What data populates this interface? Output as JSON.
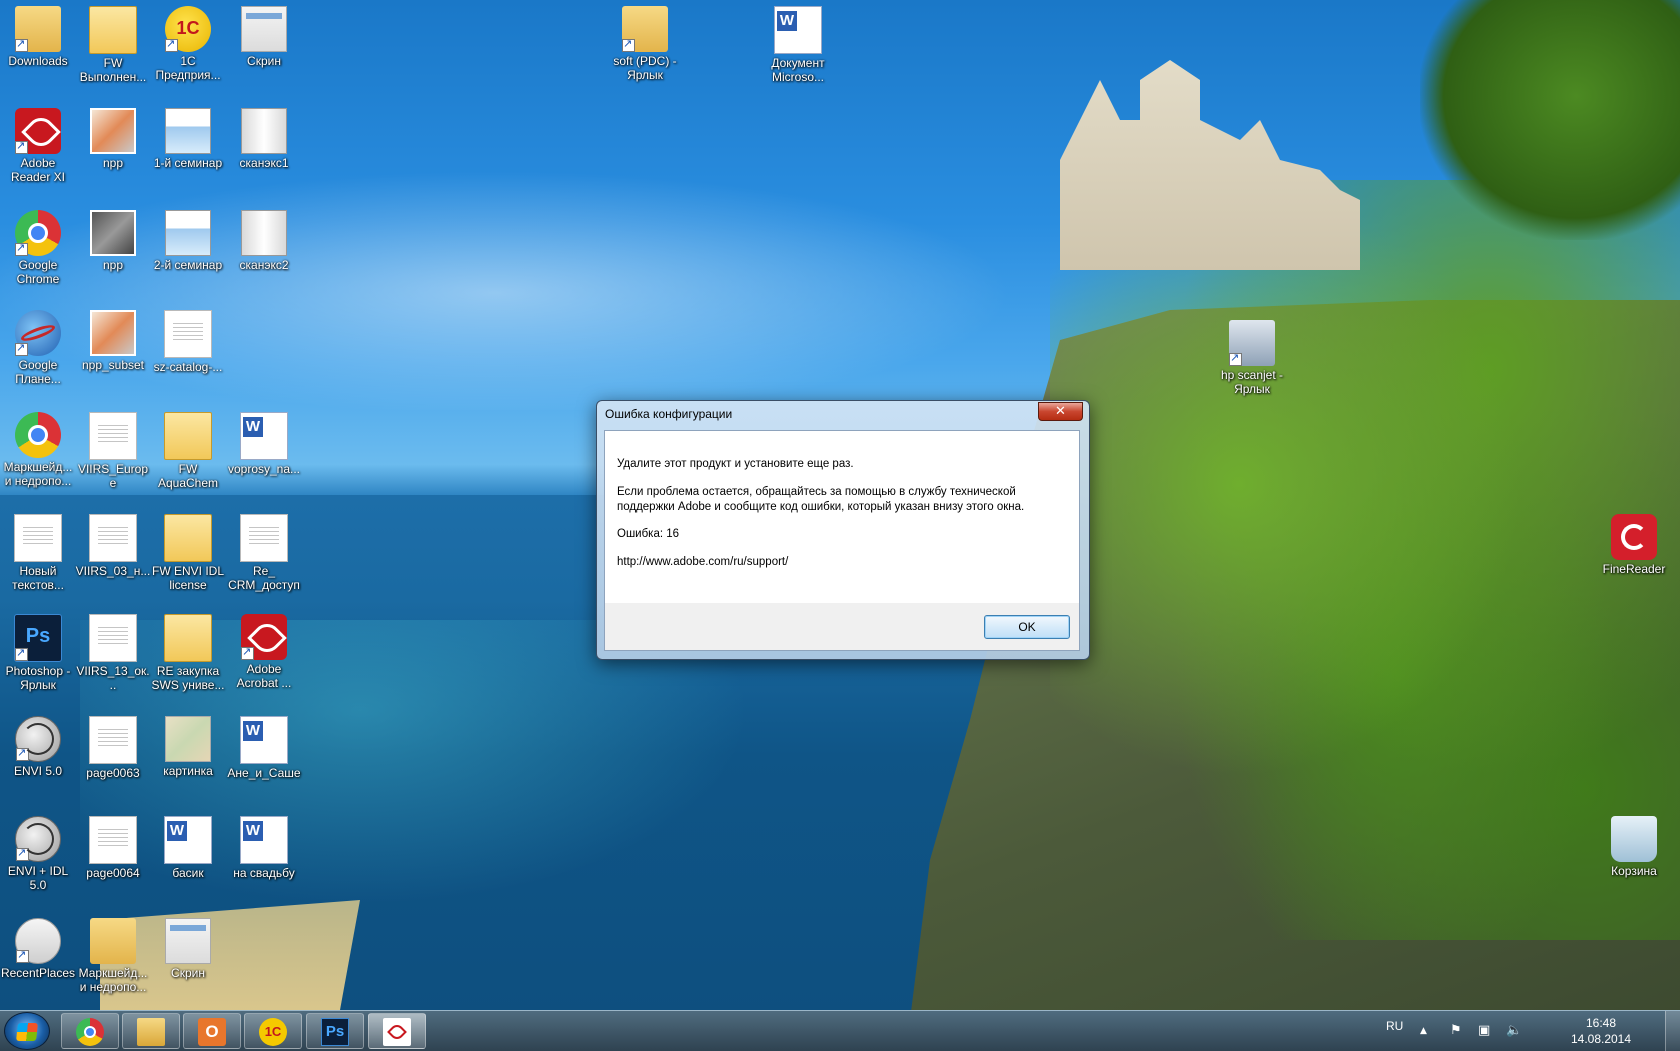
{
  "desktop_icons": [
    {
      "label": "Downloads",
      "icon": "folder-icon"
    },
    {
      "label": "FW Выполнен...",
      "icon": "mail-icon"
    },
    {
      "label": "1C Предприя...",
      "icon": "1c-icon"
    },
    {
      "label": "Скрин",
      "icon": "screenshot-icon"
    },
    {
      "label": "Adobe Reader XI",
      "icon": "pdf-icon"
    },
    {
      "label": "npp",
      "icon": "image-icon"
    },
    {
      "label": "1-й семинар",
      "icon": "slide-icon"
    },
    {
      "label": "сканэкс1",
      "icon": "scan-icon"
    },
    {
      "label": "Google Chrome",
      "icon": "chrome-icon"
    },
    {
      "label": "npp",
      "icon": "image-icon"
    },
    {
      "label": "2-й семинар",
      "icon": "slide-icon"
    },
    {
      "label": "сканэкс2",
      "icon": "scan-icon"
    },
    {
      "label": "Google Плане...",
      "icon": "google-earth-icon"
    },
    {
      "label": "npp_subset",
      "icon": "image-icon"
    },
    {
      "label": "sz-catalog-...",
      "icon": "pdf-document-icon"
    },
    {
      "label": "Маркшейд... и недропо...",
      "icon": "chrome-icon"
    },
    {
      "label": "VIIRS_Europe",
      "icon": "text-file-icon"
    },
    {
      "label": "FW AquaChem",
      "icon": "mail-icon"
    },
    {
      "label": "voprosy_na...",
      "icon": "word-icon"
    },
    {
      "label": "Новый текстов...",
      "icon": "text-file-icon"
    },
    {
      "label": "VIIRS_03_н...",
      "icon": "text-file-icon"
    },
    {
      "label": "FW ENVI IDL license",
      "icon": "mail-icon"
    },
    {
      "label": "Re_ CRM_доступ",
      "icon": "pdf-document-icon"
    },
    {
      "label": "Photoshop - Ярлык",
      "icon": "photoshop-icon"
    },
    {
      "label": "VIIRS_13_ок...",
      "icon": "text-file-icon"
    },
    {
      "label": "RE закупка SWS униве...",
      "icon": "mail-icon"
    },
    {
      "label": "Adobe Acrobat ...",
      "icon": "acrobat-icon"
    },
    {
      "label": "ENVI 5.0",
      "icon": "envi-icon"
    },
    {
      "label": "page0063",
      "icon": "document-icon"
    },
    {
      "label": "картинка",
      "icon": "map-icon"
    },
    {
      "label": "Ане_и_Саше",
      "icon": "word-icon"
    },
    {
      "label": "ENVI + IDL 5.0",
      "icon": "envi-icon"
    },
    {
      "label": "page0064",
      "icon": "document-icon"
    },
    {
      "label": "басик",
      "icon": "word-icon"
    },
    {
      "label": "на свадьбу",
      "icon": "word-icon"
    },
    {
      "label": "RecentPlaces",
      "icon": "recent-places-icon"
    },
    {
      "label": "Маркшейд... и недропо...",
      "icon": "folder-icon"
    },
    {
      "label": "Скрин",
      "icon": "screenshot-icon"
    },
    {
      "label": "soft (PDC) - Ярлык",
      "icon": "folder-icon"
    },
    {
      "label": "Документ Microso...",
      "icon": "word-icon"
    },
    {
      "label": "hp scanjet - Ярлык",
      "icon": "scanner-icon"
    },
    {
      "label": "FineReader",
      "icon": "finereader-icon"
    },
    {
      "label": "Корзина",
      "icon": "recycle-bin-icon"
    }
  ],
  "dialog": {
    "title": "Ошибка конфигурации",
    "close_label": "✕",
    "line1": "Удалите этот продукт и установите еще раз.",
    "line2": "Если проблема остается, обращайтесь за помощью в службу технической поддержки Adobe и сообщите код ошибки, который указан внизу этого окна.",
    "error_code": "Ошибка: 16",
    "url": "http://www.adobe.com/ru/support/",
    "ok_label": "OK"
  },
  "taskbar": {
    "pinned": [
      "Google Chrome",
      "Windows Explorer",
      "Outlook",
      "1C",
      "Photoshop",
      "Adobe Reader"
    ],
    "language": "RU",
    "time": "16:48",
    "date": "14.08.2014"
  }
}
